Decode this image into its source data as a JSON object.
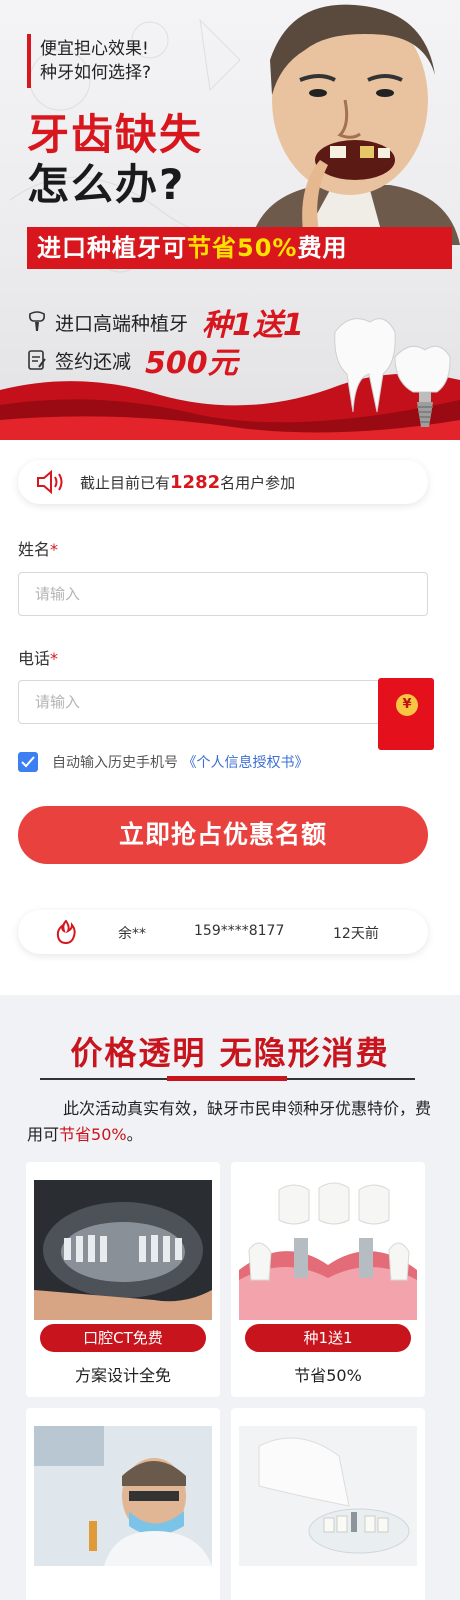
{
  "hero": {
    "question_line1": "便宜担心效果!",
    "question_line2": "种牙如何选择?",
    "title_line1": "牙齿缺失",
    "title_line2": "怎么办?",
    "banner_prefix": "进口种植牙可",
    "banner_highlight": "节省50%",
    "banner_suffix": "费用",
    "offer1_text": "进口高端种植牙",
    "offer1_big": "种1送1",
    "offer2_text": "签约还减",
    "offer2_big": "500元"
  },
  "notice": {
    "prefix": "截止目前已有",
    "count": "1282",
    "suffix": "名用户参加"
  },
  "form": {
    "name_label": "姓名",
    "phone_label": "电话",
    "required_mark": "*",
    "name_placeholder": "请输入",
    "phone_placeholder": "请输入",
    "redpack_symbol": "¥",
    "autofill_text": "自动输入历史手机号",
    "privacy_link": "《个人信息授权书》",
    "submit_label": "立即抢占优惠名额"
  },
  "ticker": {
    "name": "余**",
    "phone": "159****8177",
    "time": "12天前"
  },
  "promo": {
    "title": "价格透明 无隐形消费",
    "desc_prefix": "此次活动真实有效，缺牙市民申领种牙优惠特价，费用可",
    "desc_highlight": "节省50%",
    "desc_suffix": "。",
    "cards": [
      {
        "pill": "口腔CT免费",
        "sub": "方案设计全免"
      },
      {
        "pill": "种1送1",
        "sub": "节省50%"
      },
      {
        "pill": "",
        "sub": ""
      },
      {
        "pill": "",
        "sub": ""
      }
    ]
  },
  "colors": {
    "brand_red": "#d7161d",
    "cta_red": "#e8413e",
    "checkbox_blue": "#3b7ff2",
    "link_blue": "#3b6fd6"
  }
}
